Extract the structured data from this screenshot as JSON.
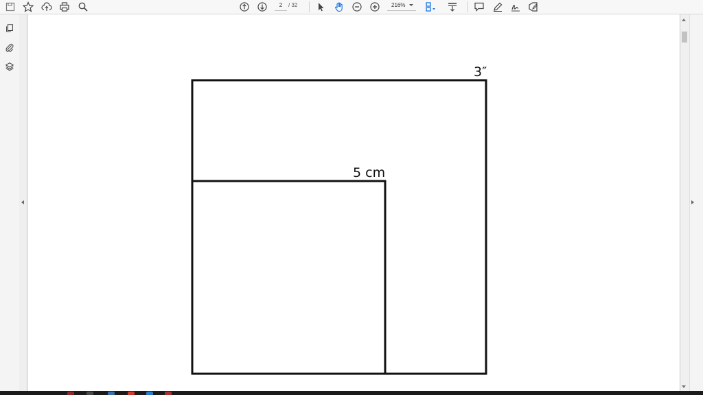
{
  "toolbar": {
    "page_current": "2",
    "page_total": "/ 32",
    "zoom": "216%"
  },
  "figure": {
    "large_square_label": "3″",
    "small_square_label": "5 cm"
  },
  "colors": {
    "accent": "#1473e6",
    "line": "#111111",
    "toolbar_bg": "#f7f7f7"
  },
  "icons": [
    "save-icon",
    "star-icon",
    "upload-cloud-icon",
    "print-icon",
    "search-icon",
    "page-up-icon",
    "page-down-icon",
    "select-cursor-icon",
    "hand-tool-icon",
    "zoom-out-icon",
    "zoom-in-icon",
    "page-layout-icon",
    "scroll-mode-icon",
    "comment-icon",
    "highlight-pen-icon",
    "sign-icon",
    "fill-sign-icon",
    "pages-thumbnail-icon",
    "attachment-icon",
    "layers-icon"
  ]
}
